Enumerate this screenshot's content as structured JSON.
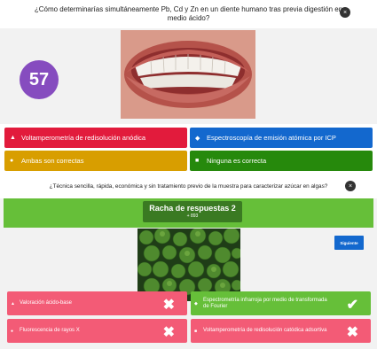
{
  "question1": {
    "text": "¿Cómo determinarías simultáneamente Pb, Cd y Zn en un diente humano tras previa digestión en medio ácido?",
    "timer": "57",
    "answers": [
      {
        "symbol": "▲",
        "label": "Voltamperometría de redisolución anódica"
      },
      {
        "symbol": "◆",
        "label": "Espectroscopía de emisión atómica por ICP"
      },
      {
        "symbol": "●",
        "label": "Ambas son correctas"
      },
      {
        "symbol": "■",
        "label": "Ninguna es correcta"
      }
    ]
  },
  "question2": {
    "text": "¿Técnica sencilla, rápida, económica y sin tratamiento previo de la muestra  para caracterizar azúcar en algas?",
    "streak_title": "Racha de respuestas 2",
    "streak_points": "+ 893",
    "next_label": "Siguiente",
    "answers": [
      {
        "symbol": "▲",
        "label": "Valoración ácido-base",
        "mark": "✖"
      },
      {
        "symbol": "◆",
        "label": "Espectrometría infrarroja por medio de transformada de Fourier",
        "mark": "✔"
      },
      {
        "symbol": "●",
        "label": "Fluorescencia de rayos X",
        "mark": "✖"
      },
      {
        "symbol": "■",
        "label": "Voltamperometría de redisolución catódica adsortiva",
        "mark": "✖"
      }
    ]
  },
  "icons": {
    "close": "×"
  },
  "colors": {
    "red": "#e21b3c",
    "blue": "#1368ce",
    "yellow": "#d89e00",
    "green": "#26890c",
    "purple_timer": "#864cbf",
    "correct_green": "#66bf39",
    "wrong_pink": "#f35b76"
  }
}
